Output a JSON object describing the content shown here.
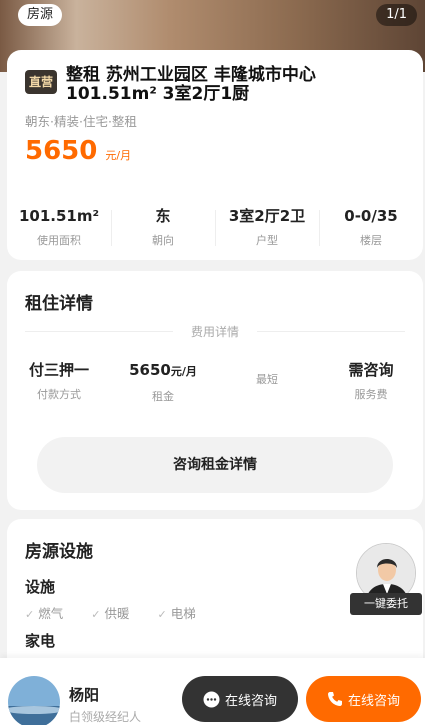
{
  "hero": {
    "tag": "房源",
    "counter": "1/1"
  },
  "listing": {
    "badge": "直营",
    "title": "整租 苏州工业园区 丰隆城市中心 101.51m² 3室2厅1厨",
    "tags": "朝东·精装·住宅·整租",
    "price": "5650",
    "price_unit": "元/月",
    "stats": [
      {
        "value": "101.51m²",
        "label": "使用面积"
      },
      {
        "value": "东",
        "label": "朝向"
      },
      {
        "value": "3室2厅2卫",
        "label": "户型"
      },
      {
        "value": "0-0/35",
        "label": "楼层"
      }
    ]
  },
  "rent": {
    "title": "租住详情",
    "divider": "费用详情",
    "fees": [
      {
        "value": "付三押一",
        "label": "付款方式"
      },
      {
        "value": "5650",
        "unit": "元/月",
        "label": "租金"
      },
      {
        "label": "最短"
      },
      {
        "value": "需咨询",
        "label": "服务费"
      }
    ],
    "consult_button": "咨询租金详情"
  },
  "facilities": {
    "title": "房源设施",
    "sub1": "设施",
    "items": [
      "燃气",
      "供暖",
      "电梯"
    ],
    "sub2": "家电"
  },
  "float_agent": {
    "label": "一键委托"
  },
  "bottom": {
    "name": "杨阳",
    "role": "白领级经纪人",
    "chat_button": "在线咨询",
    "call_button": "在线咨询"
  },
  "colors": {
    "accent": "#ff6a00",
    "dark_button": "#333333",
    "badge_bg": "#3a342e",
    "badge_text": "#f1d7a6"
  }
}
